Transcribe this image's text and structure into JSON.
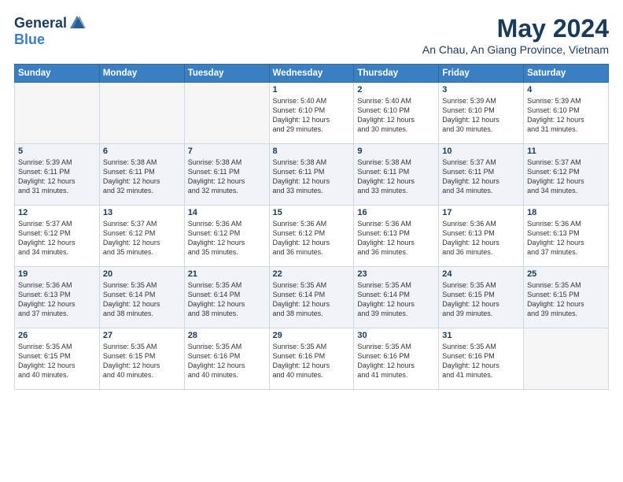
{
  "logo": {
    "general": "General",
    "blue": "Blue"
  },
  "title": {
    "month": "May 2024",
    "location": "An Chau, An Giang Province, Vietnam"
  },
  "days_header": [
    "Sunday",
    "Monday",
    "Tuesday",
    "Wednesday",
    "Thursday",
    "Friday",
    "Saturday"
  ],
  "weeks": [
    {
      "cells": [
        {
          "day": "",
          "content": ""
        },
        {
          "day": "",
          "content": ""
        },
        {
          "day": "",
          "content": ""
        },
        {
          "day": "1",
          "content": "Sunrise: 5:40 AM\nSunset: 6:10 PM\nDaylight: 12 hours\nand 29 minutes."
        },
        {
          "day": "2",
          "content": "Sunrise: 5:40 AM\nSunset: 6:10 PM\nDaylight: 12 hours\nand 30 minutes."
        },
        {
          "day": "3",
          "content": "Sunrise: 5:39 AM\nSunset: 6:10 PM\nDaylight: 12 hours\nand 30 minutes."
        },
        {
          "day": "4",
          "content": "Sunrise: 5:39 AM\nSunset: 6:10 PM\nDaylight: 12 hours\nand 31 minutes."
        }
      ]
    },
    {
      "cells": [
        {
          "day": "5",
          "content": "Sunrise: 5:39 AM\nSunset: 6:11 PM\nDaylight: 12 hours\nand 31 minutes."
        },
        {
          "day": "6",
          "content": "Sunrise: 5:38 AM\nSunset: 6:11 PM\nDaylight: 12 hours\nand 32 minutes."
        },
        {
          "day": "7",
          "content": "Sunrise: 5:38 AM\nSunset: 6:11 PM\nDaylight: 12 hours\nand 32 minutes."
        },
        {
          "day": "8",
          "content": "Sunrise: 5:38 AM\nSunset: 6:11 PM\nDaylight: 12 hours\nand 33 minutes."
        },
        {
          "day": "9",
          "content": "Sunrise: 5:38 AM\nSunset: 6:11 PM\nDaylight: 12 hours\nand 33 minutes."
        },
        {
          "day": "10",
          "content": "Sunrise: 5:37 AM\nSunset: 6:11 PM\nDaylight: 12 hours\nand 34 minutes."
        },
        {
          "day": "11",
          "content": "Sunrise: 5:37 AM\nSunset: 6:12 PM\nDaylight: 12 hours\nand 34 minutes."
        }
      ]
    },
    {
      "cells": [
        {
          "day": "12",
          "content": "Sunrise: 5:37 AM\nSunset: 6:12 PM\nDaylight: 12 hours\nand 34 minutes."
        },
        {
          "day": "13",
          "content": "Sunrise: 5:37 AM\nSunset: 6:12 PM\nDaylight: 12 hours\nand 35 minutes."
        },
        {
          "day": "14",
          "content": "Sunrise: 5:36 AM\nSunset: 6:12 PM\nDaylight: 12 hours\nand 35 minutes."
        },
        {
          "day": "15",
          "content": "Sunrise: 5:36 AM\nSunset: 6:12 PM\nDaylight: 12 hours\nand 36 minutes."
        },
        {
          "day": "16",
          "content": "Sunrise: 5:36 AM\nSunset: 6:13 PM\nDaylight: 12 hours\nand 36 minutes."
        },
        {
          "day": "17",
          "content": "Sunrise: 5:36 AM\nSunset: 6:13 PM\nDaylight: 12 hours\nand 36 minutes."
        },
        {
          "day": "18",
          "content": "Sunrise: 5:36 AM\nSunset: 6:13 PM\nDaylight: 12 hours\nand 37 minutes."
        }
      ]
    },
    {
      "cells": [
        {
          "day": "19",
          "content": "Sunrise: 5:36 AM\nSunset: 6:13 PM\nDaylight: 12 hours\nand 37 minutes."
        },
        {
          "day": "20",
          "content": "Sunrise: 5:35 AM\nSunset: 6:14 PM\nDaylight: 12 hours\nand 38 minutes."
        },
        {
          "day": "21",
          "content": "Sunrise: 5:35 AM\nSunset: 6:14 PM\nDaylight: 12 hours\nand 38 minutes."
        },
        {
          "day": "22",
          "content": "Sunrise: 5:35 AM\nSunset: 6:14 PM\nDaylight: 12 hours\nand 38 minutes."
        },
        {
          "day": "23",
          "content": "Sunrise: 5:35 AM\nSunset: 6:14 PM\nDaylight: 12 hours\nand 39 minutes."
        },
        {
          "day": "24",
          "content": "Sunrise: 5:35 AM\nSunset: 6:15 PM\nDaylight: 12 hours\nand 39 minutes."
        },
        {
          "day": "25",
          "content": "Sunrise: 5:35 AM\nSunset: 6:15 PM\nDaylight: 12 hours\nand 39 minutes."
        }
      ]
    },
    {
      "cells": [
        {
          "day": "26",
          "content": "Sunrise: 5:35 AM\nSunset: 6:15 PM\nDaylight: 12 hours\nand 40 minutes."
        },
        {
          "day": "27",
          "content": "Sunrise: 5:35 AM\nSunset: 6:15 PM\nDaylight: 12 hours\nand 40 minutes."
        },
        {
          "day": "28",
          "content": "Sunrise: 5:35 AM\nSunset: 6:16 PM\nDaylight: 12 hours\nand 40 minutes."
        },
        {
          "day": "29",
          "content": "Sunrise: 5:35 AM\nSunset: 6:16 PM\nDaylight: 12 hours\nand 40 minutes."
        },
        {
          "day": "30",
          "content": "Sunrise: 5:35 AM\nSunset: 6:16 PM\nDaylight: 12 hours\nand 41 minutes."
        },
        {
          "day": "31",
          "content": "Sunrise: 5:35 AM\nSunset: 6:16 PM\nDaylight: 12 hours\nand 41 minutes."
        },
        {
          "day": "",
          "content": ""
        }
      ]
    }
  ]
}
